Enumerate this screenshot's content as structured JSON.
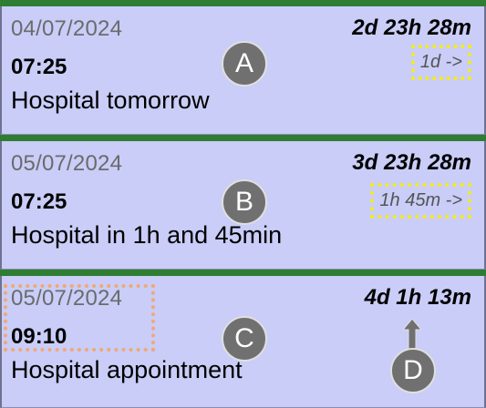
{
  "reminders": [
    {
      "date": "04/07/2024",
      "time": "07:25",
      "title": "Hospital tomorrow",
      "countdown": "2d 23h 28m",
      "offset": "1d ->",
      "label": "A"
    },
    {
      "date": "05/07/2024",
      "time": "07:25",
      "title": "Hospital in 1h and 45min",
      "countdown": "3d 23h 28m",
      "offset": "1h 45m ->",
      "label": "B"
    },
    {
      "date": "05/07/2024",
      "time": "09:10",
      "title": "Hospital appointment",
      "countdown": "4d 1h 13m",
      "label": "C"
    }
  ],
  "annotation_d": "D",
  "colors": {
    "card_bg": "#c9cdf7",
    "top_bar": "#2e7d32",
    "highlight_yellow": "#f4ec17",
    "highlight_orange": "#f0a877",
    "badge": "#707070"
  }
}
